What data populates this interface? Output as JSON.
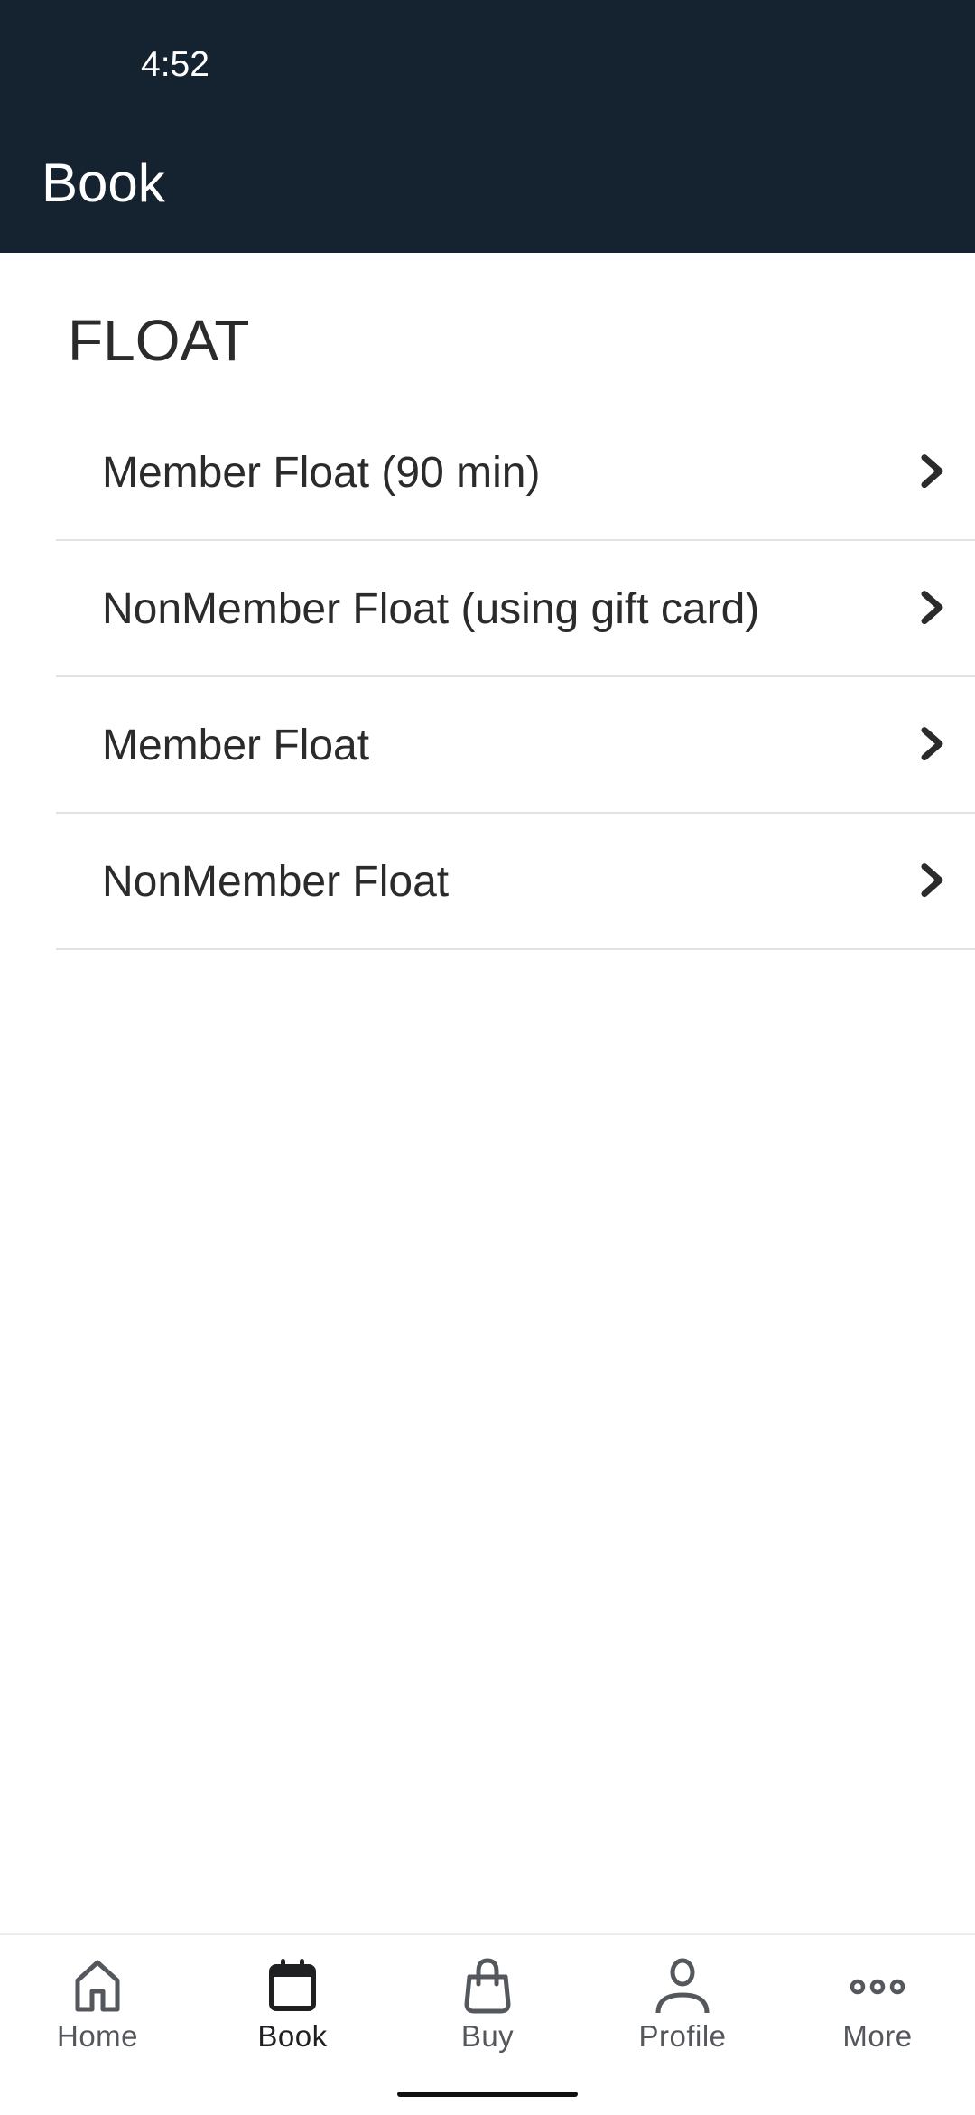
{
  "status_bar": {
    "time": "4:52"
  },
  "header": {
    "title": "Book"
  },
  "section": {
    "title": "FLOAT",
    "items": [
      {
        "label": "Member Float (90 min)",
        "icon": "chevron-right-icon"
      },
      {
        "label": "NonMember Float (using gift card)",
        "icon": "chevron-right-icon"
      },
      {
        "label": "Member Float",
        "icon": "chevron-right-icon"
      },
      {
        "label": "NonMember Float",
        "icon": "chevron-right-icon"
      }
    ]
  },
  "tabbar": {
    "active": "Book",
    "tabs": [
      {
        "label": "Home",
        "icon": "home-icon"
      },
      {
        "label": "Book",
        "icon": "calendar-icon"
      },
      {
        "label": "Buy",
        "icon": "shopping-bag-icon"
      },
      {
        "label": "Profile",
        "icon": "person-icon"
      },
      {
        "label": "More",
        "icon": "more-dots-icon"
      }
    ]
  },
  "colors": {
    "header_bg": "#14232f",
    "text": "#2b2b2b",
    "tab_inactive": "#54575c",
    "tab_active": "#1f2022"
  }
}
